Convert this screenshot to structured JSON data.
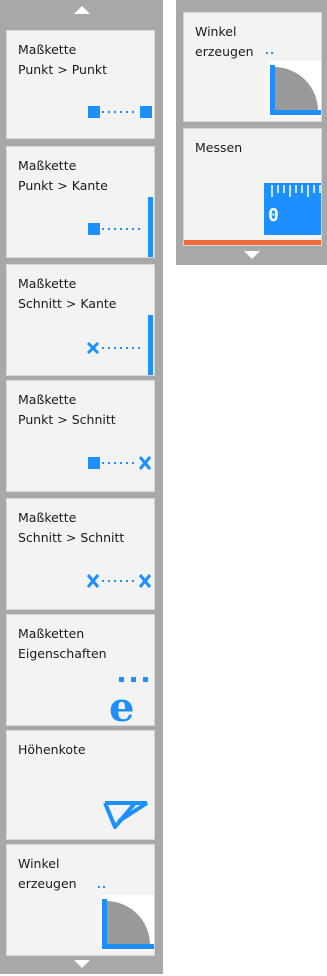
{
  "left_panel": {
    "tools": [
      {
        "label": "Maßkette\nPunkt > Punkt",
        "icon": "dimension-point-point-icon"
      },
      {
        "label": "Maßkette\nPunkt > Kante",
        "icon": "dimension-point-edge-icon"
      },
      {
        "label": "Maßkette\nSchnitt > Kante",
        "icon": "dimension-intersection-edge-icon"
      },
      {
        "label": "Maßkette\nPunkt > Schnitt",
        "icon": "dimension-point-intersection-icon"
      },
      {
        "label": "Maßkette\nSchnitt > Schnitt",
        "icon": "dimension-intersection-intersection-icon"
      },
      {
        "label": "Maßketten\nEigenschaften",
        "icon": "dimension-properties-icon"
      },
      {
        "label": "Höhenkote",
        "icon": "elevation-marker-icon"
      },
      {
        "label": "Winkel\nerzeugen",
        "icon": "angle-create-icon"
      }
    ]
  },
  "right_panel": {
    "tools": [
      {
        "label": "Winkel\nerzeugen",
        "icon": "angle-create-icon"
      },
      {
        "label": "Messen",
        "icon": "measure-ruler-icon",
        "ruler_value": "0"
      }
    ]
  },
  "colors": {
    "accent": "#1e8fff",
    "panel_bg": "#a8a8a8",
    "tile_bg": "#f3f3f3",
    "highlight_bar": "#f06a3a",
    "angle_fill": "#999999"
  }
}
